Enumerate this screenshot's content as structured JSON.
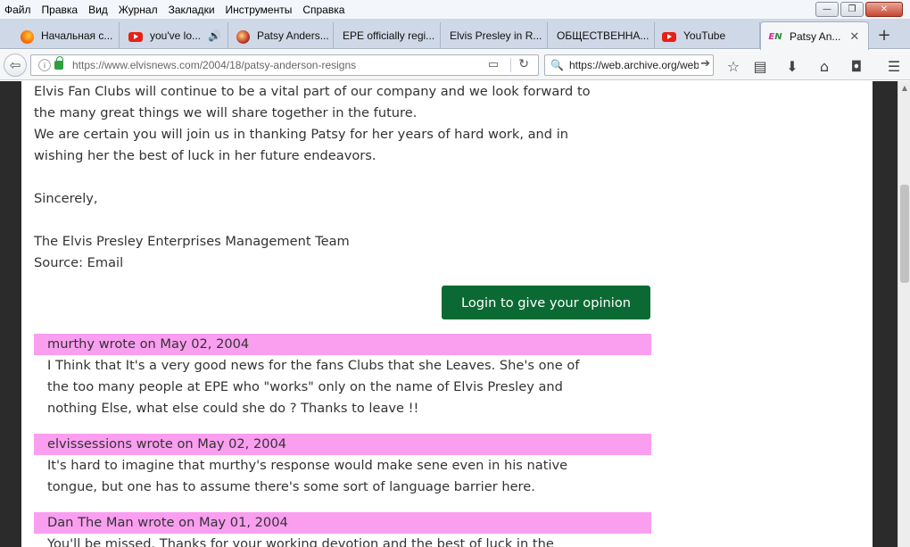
{
  "menu": [
    "Файл",
    "Правка",
    "Вид",
    "Журнал",
    "Закладки",
    "Инструменты",
    "Справка"
  ],
  "window_controls": {
    "minimize": "—",
    "maximize": "❐",
    "close": "✕"
  },
  "tabs": [
    {
      "label": "Начальная с...",
      "icon": "firefox-icon"
    },
    {
      "label": "you've lo...",
      "icon": "youtube-icon",
      "audio": "🔊"
    },
    {
      "label": "Patsy Anders...",
      "icon": "elvis-icon"
    },
    {
      "label": "EPE officially regi..."
    },
    {
      "label": "Elvis Presley in R..."
    },
    {
      "label": "ОБЩЕСТВЕННА..."
    },
    {
      "label": "YouTube",
      "icon": "youtube-icon"
    },
    {
      "label": "Patsy An...",
      "icon": "elvisnews-icon",
      "active": true,
      "close": "✕"
    }
  ],
  "newtab_label": "+",
  "url": "https://www.elvisnews.com/2004/18/patsy-anderson-resigns",
  "search_value": "https://web.archive.org/web",
  "article": {
    "lines": [
      "Elvis Fan Clubs will continue to be a vital part of our company and we look forward to",
      "the many great things we will share together in the future.",
      "We are certain you will join us in thanking Patsy for her years of hard work, and in",
      "wishing her the best of luck in her future endeavors."
    ],
    "closing": "Sincerely,",
    "signature": "The Elvis Presley Enterprises Management Team",
    "source": "Source: Email"
  },
  "login_button": "Login to give your opinion",
  "comments": [
    {
      "header": "murthy wrote on May 02, 2004",
      "lines": [
        "I Think that It's a very good news for the fans Clubs that she Leaves. She's one of",
        "the too many people at EPE who \"works\" only on the name of Elvis Presley and",
        "nothing Else, what else could she do ? Thanks to leave !!"
      ]
    },
    {
      "header": "elvissessions wrote on May 02, 2004",
      "lines": [
        "It's hard to imagine that murthy's response would make sene even in his native",
        "tongue, but one has to assume there's some sort of language barrier here."
      ]
    },
    {
      "header": "Dan The Man wrote on May 01, 2004",
      "lines": [
        "You'll be missed. Thanks for your working devotion and the best of luck in the"
      ]
    }
  ]
}
